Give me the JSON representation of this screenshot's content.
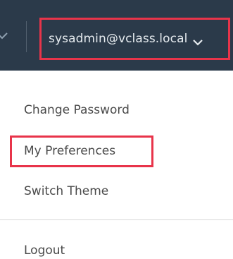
{
  "header": {
    "user_menu_label": "sysadmin@vclass.local",
    "caret_icon": "chevron-down-icon",
    "prev_icon": "chevron-down-icon"
  },
  "dropdown": {
    "items": [
      {
        "label": "Change Password"
      },
      {
        "label": "My Preferences"
      },
      {
        "label": "Switch Theme"
      },
      {
        "label": "Logout"
      }
    ]
  },
  "colors": {
    "header_bg": "#2b3a4a",
    "highlight": "#e8344a",
    "menu_text": "#4a4a4a"
  }
}
